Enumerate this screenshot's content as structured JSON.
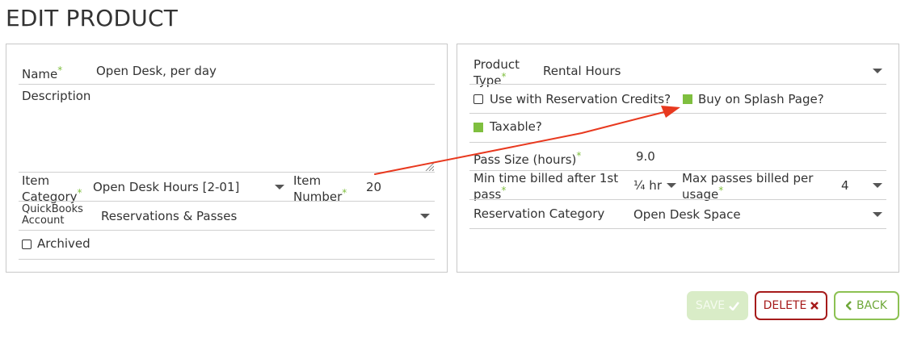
{
  "page": {
    "title": "EDIT PRODUCT"
  },
  "left": {
    "name_label": "Name",
    "name_value": "Open Desk, per day",
    "description_label": "Description",
    "description_value": "",
    "item_category_label_1": "Item",
    "item_category_label_2": "Category",
    "item_category_value": "Open Desk Hours [2-01]",
    "item_number_label_1": "Item",
    "item_number_label_2": "Number",
    "item_number_value": "20",
    "qb_label_1": "QuickBooks",
    "qb_label_2": "Account",
    "qb_value": "Reservations & Passes",
    "archived_label": "Archived"
  },
  "right": {
    "product_type_label_1": "Product",
    "product_type_label_2": "Type",
    "product_type_value": "Rental Hours",
    "reservation_credits_label": "Use with Reservation Credits?",
    "splash_label": "Buy on Splash Page?",
    "taxable_label": "Taxable?",
    "pass_size_label": "Pass Size (hours)",
    "pass_size_value": "9.0",
    "min_time_label_1": "Min time billed after 1st",
    "min_time_label_2": "pass",
    "min_time_value": "¼ hr",
    "max_passes_label_1": "Max passes billed per",
    "max_passes_label_2": "usage",
    "max_passes_value": "4",
    "reservation_category_label": "Reservation Category",
    "reservation_category_value": "Open Desk Space"
  },
  "checkboxes": {
    "use_with_reservation_credits": false,
    "buy_on_splash_page": true,
    "taxable": true,
    "archived": false
  },
  "actions": {
    "save_label": "SAVE",
    "delete_label": "DELETE",
    "back_label": "BACK"
  },
  "colors": {
    "accent_green": "#7fbf3f",
    "delete_red": "#a61b1b",
    "annotation_arrow": "#e8391f"
  }
}
